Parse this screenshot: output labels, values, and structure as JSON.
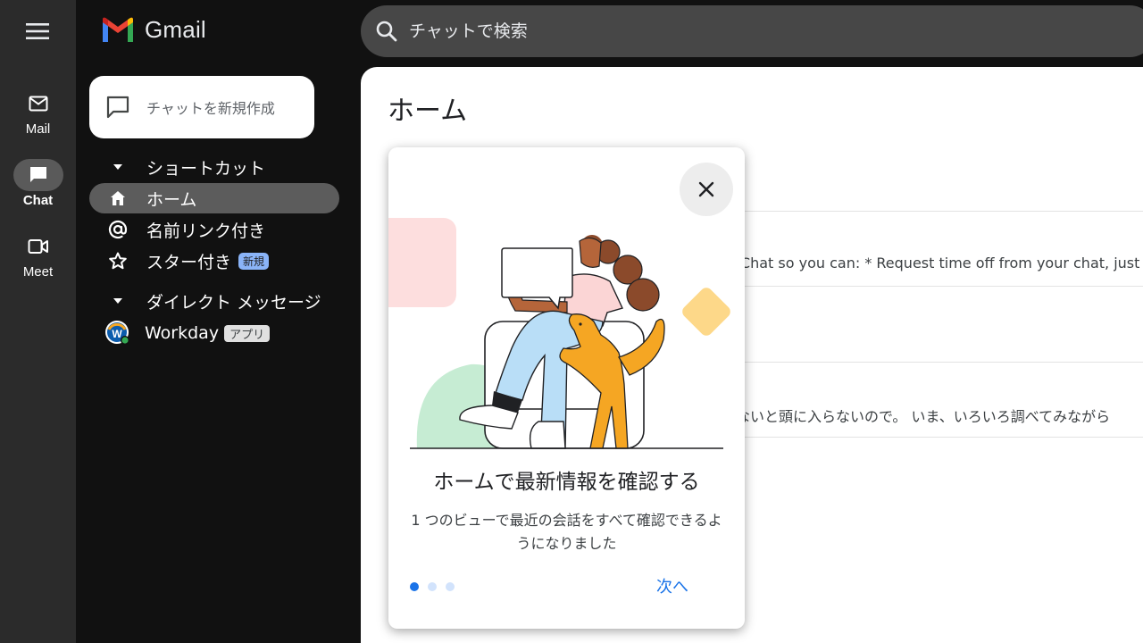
{
  "app": {
    "name": "Gmail"
  },
  "search": {
    "placeholder": "チャットで検索"
  },
  "rail": {
    "items": [
      {
        "label": "Mail"
      },
      {
        "label": "Chat"
      },
      {
        "label": "Meet"
      }
    ]
  },
  "compose": {
    "label": "チャットを新規作成"
  },
  "sidebar": {
    "shortcuts_header": "ショートカット",
    "items": [
      {
        "label": "ホーム"
      },
      {
        "label": "名前リンク付き"
      },
      {
        "label": "スター付き",
        "badge": "新規"
      }
    ],
    "dm_header": "ダイレクト メッセージ",
    "dms": [
      {
        "label": "Workday",
        "badge": "アプリ",
        "avatar_letter": "W"
      }
    ]
  },
  "main": {
    "title": "ホーム",
    "snippets": [
      "e Chat so you can: * Request time off from your chat, just",
      "ないと頭に入らないので。 いま、いろいろ調べてみながら"
    ]
  },
  "popup": {
    "title": "ホームで最新情報を確認する",
    "description": "1 つのビューで最近の会話をすべて確認できるようになりました",
    "next_label": "次へ",
    "pages_total": 3,
    "page_current": 1
  },
  "colors": {
    "accent": "#1a73e8",
    "rail_bg": "#2b2b2b",
    "sidebar_bg": "#111111",
    "search_bg": "#474747",
    "active_nav": "#5c5c5c"
  }
}
